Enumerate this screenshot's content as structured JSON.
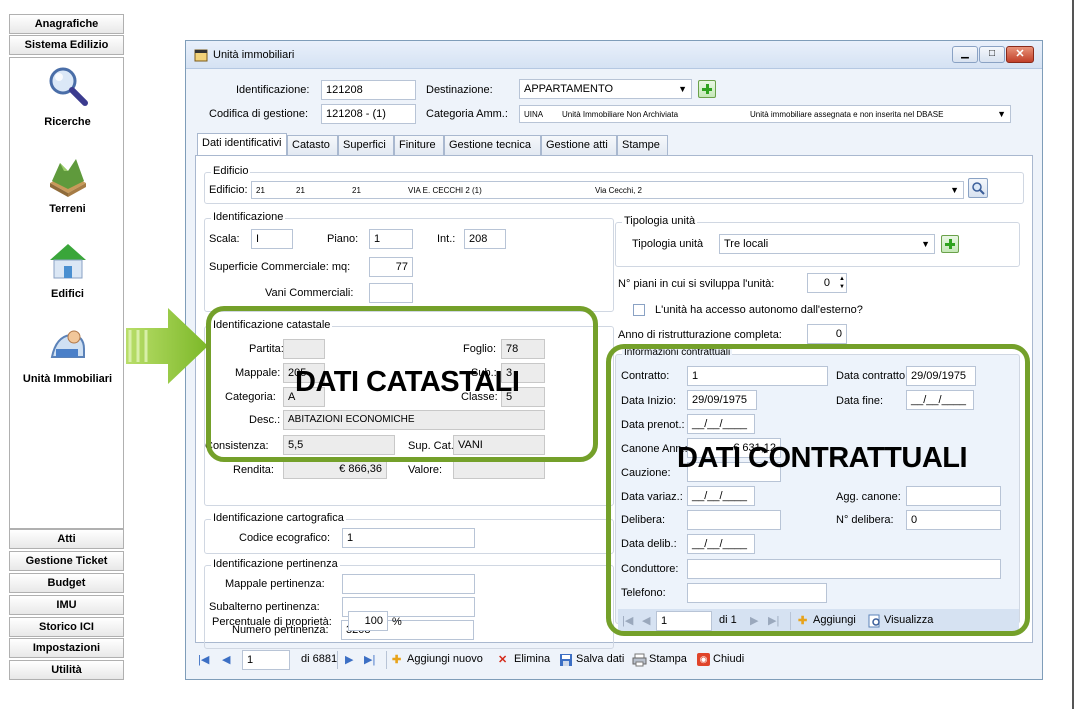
{
  "sidebar": {
    "top_buttons": [
      "Anagrafiche",
      "Sistema Edilizio"
    ],
    "items": [
      {
        "label": "Ricerche",
        "icon": "magnifier-icon"
      },
      {
        "label": "Terreni",
        "icon": "terrain-icon"
      },
      {
        "label": "Edifici",
        "icon": "house-icon"
      },
      {
        "label": "Unità Immobiliari",
        "icon": "units-icon"
      }
    ],
    "bottom_buttons": [
      "Atti",
      "Gestione Ticket",
      "Budget",
      "IMU",
      "Storico ICI",
      "Impostazioni",
      "Utilità"
    ]
  },
  "window": {
    "title": "Unità immobiliari",
    "header": {
      "identificazione_label": "Identificazione:",
      "identificazione_value": "121208",
      "destinazione_label": "Destinazione:",
      "destinazione_value": "APPARTAMENTO",
      "codifica_label": "Codifica di gestione:",
      "codifica_value": "121208 - (1)",
      "categoria_label": "Categoria Amm.:",
      "categoria_code": "UINA",
      "categoria_desc": "Unità Immobiliare Non Archiviata",
      "categoria_note": "Unità immobiliare assegnata e non inserita nel DBASE"
    },
    "tabs": [
      "Dati identificativi",
      "Catasto",
      "Superfici",
      "Finiture",
      "Gestione tecnica",
      "Gestione atti",
      "Stampe"
    ],
    "edificio": {
      "group_title": "Edificio",
      "label": "Edificio:",
      "values": [
        "21",
        "21",
        "21",
        "VIA E. CECCHI 2 (1)",
        "Via Cecchi, 2"
      ]
    },
    "identificazione": {
      "group_title": "Identificazione",
      "scala_label": "Scala:",
      "scala_value": "I",
      "piano_label": "Piano:",
      "piano_value": "1",
      "int_label": "Int.:",
      "int_value": "208",
      "sup_label": "Superficie Commerciale:  mq:",
      "sup_value": "77",
      "vani_label": "Vani Commerciali:",
      "vani_value": ""
    },
    "catastale": {
      "group_title": "Identificazione catastale",
      "partita_label": "Partita:",
      "partita_value": "",
      "foglio_label": "Foglio:",
      "foglio_value": "78",
      "mappale_label": "Mappale:",
      "mappale_value": "205",
      "sub_label": "Sub.:",
      "sub_value": "3",
      "categoria_label": "Categoria:",
      "categoria_value": "A",
      "classe_label": "Classe:",
      "classe_value": "5",
      "desc_label": "Desc.:",
      "desc_value": "ABITAZIONI ECONOMICHE",
      "consistenza_label": "Consistenza:",
      "consistenza_value": "5,5",
      "supcat_label": "Sup. Cat.:",
      "supcat_value": "VANI",
      "rendita_label": "Rendita:",
      "rendita_value": "€ 866,36",
      "valore_label": "Valore:",
      "valore_value": ""
    },
    "cartografica": {
      "group_title": "Identificazione cartografica",
      "codice_label": "Codice ecografico:",
      "codice_value": "1"
    },
    "pertinenza": {
      "group_title": "Identificazione pertinenza",
      "mappale_label": "Mappale pertinenza:",
      "mappale_value": "",
      "subalterno_label": "Subalterno pertinenza:",
      "subalterno_value": "",
      "numero_label": "Numero pertinenza:",
      "numero_value": "3208"
    },
    "percentuale_label": "Percentuale di proprietà:",
    "percentuale_value": "100",
    "percentuale_unit": "%",
    "tipologia": {
      "group_title": "Tipologia unità",
      "label": "Tipologia unità",
      "value": "Tre locali"
    },
    "npiani_label": "N° piani in cui si sviluppa l'unità:",
    "npiani_value": "0",
    "accesso_label": "L'unità ha accesso autonomo dall'esterno?",
    "anno_label": "Anno di ristrutturazione completa:",
    "anno_value": "0",
    "contrattuali": {
      "group_title": "Informazioni contrattuali",
      "contratto_label": "Contratto:",
      "contratto_value": "1",
      "data_contratto_label": "Data contratto:",
      "data_contratto_value": "29/09/1975",
      "data_inizio_label": "Data Inizio:",
      "data_inizio_value": "29/09/1975",
      "data_fine_label": "Data fine:",
      "data_fine_value": "__/__/____",
      "data_prenot_label": "Data prenot.:",
      "data_prenot_value": "__/__/____",
      "canone_label": "Canone Ann.:",
      "canone_value": "€ 631,12",
      "cauzione_label": "Cauzione:",
      "cauzione_value": "",
      "data_variaz_label": "Data variaz.:",
      "data_variaz_value": "__/__/____",
      "agg_canone_label": "Agg. canone:",
      "agg_canone_value": "",
      "delibera_label": "Delibera:",
      "delibera_value": "",
      "n_delibera_label": "N° delibera:",
      "n_delibera_value": "0",
      "data_delib_label": "Data delib.:",
      "data_delib_value": "__/__/____",
      "conduttore_label": "Conduttore:",
      "conduttore_value": "",
      "telefono_label": "Telefono:",
      "telefono_value": "",
      "nav_page": "1",
      "nav_of": "di 1",
      "add_label": "Aggiungi",
      "view_label": "Visualizza"
    },
    "bottom_nav": {
      "page": "1",
      "of": "di 6881",
      "add_new": "Aggiungi nuovo",
      "delete": "Elimina",
      "save": "Salva dati",
      "print": "Stampa",
      "close": "Chiudi"
    }
  },
  "annotations": {
    "catastali": "DATI CATASTALI",
    "contrattuali": "DATI CONTRATTUALI"
  },
  "colors": {
    "highlight_green": "#74a02a",
    "arrow_green": "#8dc63f"
  }
}
